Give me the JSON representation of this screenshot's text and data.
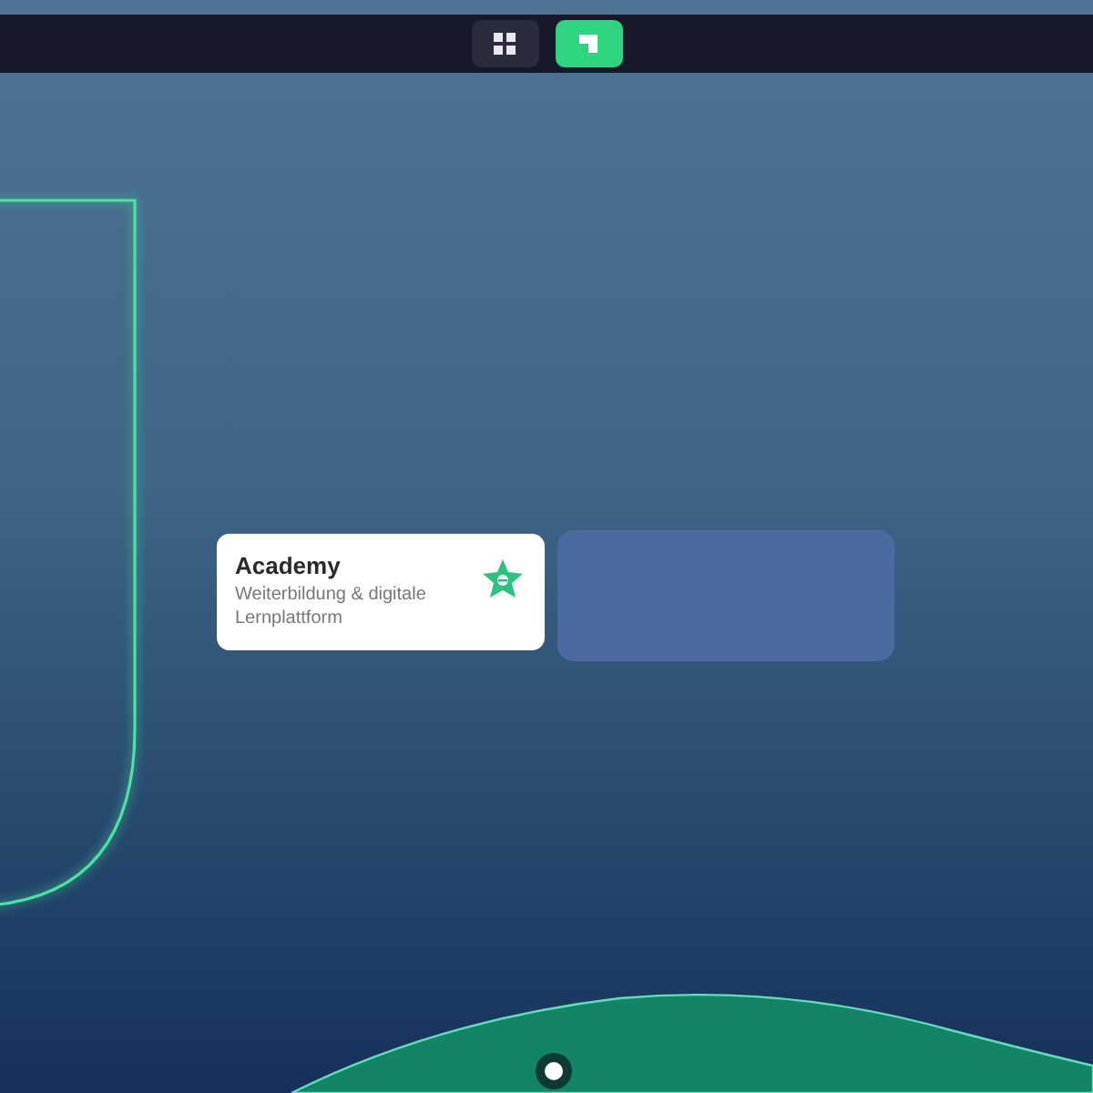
{
  "toolbar": {
    "buttons": [
      {
        "kind": "grid",
        "selected": false
      },
      {
        "kind": "corner",
        "selected": true
      }
    ]
  },
  "cards": [
    {
      "kind": "app",
      "title": "Academy",
      "subtitle": "Weiterbildung & digitale Lernplattform"
    },
    {
      "kind": "empty"
    }
  ]
}
